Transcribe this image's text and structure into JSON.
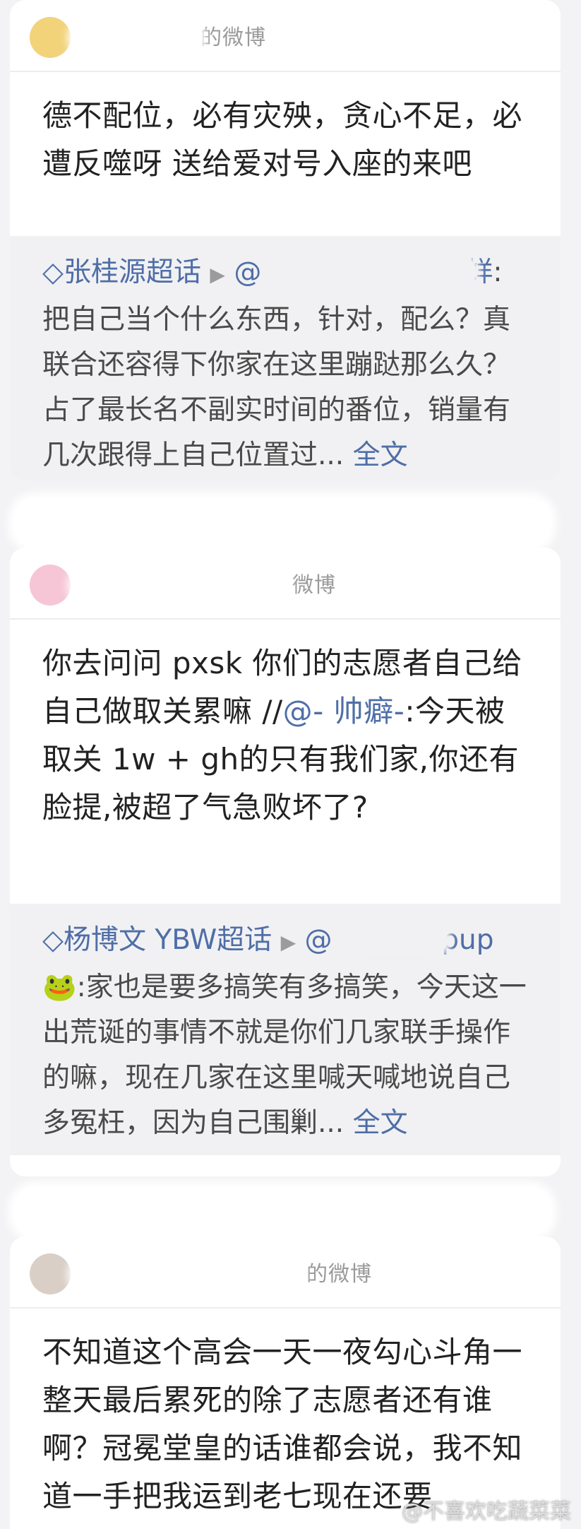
{
  "posts": [
    {
      "header": "的微博",
      "body": "德不配位，必有灾殃，贪心不足，必遭反噬呀 送给爱对号入座的来吧",
      "quote": {
        "topic": "张桂源超话",
        "mention": "@",
        "mention_tail": "打烊",
        "text": ":把自己当个什么东西，针对，配么？真联合还容得下你家在这里蹦跶那么久？占了最长名不副实时间的番位，销量有几次跟得上自己位置过...",
        "full_label": "全文"
      }
    },
    {
      "header": "微博",
      "body_before": "你去问问 pxsk 你们的志愿者自己给自己做取关累嘛 //",
      "body_mention": "@- 帅癖-",
      "body_after": ":今天被取关 1w + gh的只有我们家,你还有脸提,被超了气急败坏了?",
      "quote": {
        "topic": "杨博文 YBW超话",
        "mention": "@",
        "mention_tail": "upup",
        "emoji": "🐸",
        "text": ":家也是要多搞笑有多搞笑，今天这一出荒诞的事情不就是你们几家联手操作的嘛，现在几家在这里喊天喊地说自己多冤枉，因为自己围剿...",
        "full_label": "全文"
      }
    },
    {
      "header": "的微博",
      "body": "不知道这个高会一天一夜勾心斗角一整天最后累死的除了志愿者还有谁啊？冠冕堂皇的话谁都会说，我不知道一手把我运到老七现在还要"
    }
  ],
  "watermark": "@不喜欢吃蔬菜菜"
}
